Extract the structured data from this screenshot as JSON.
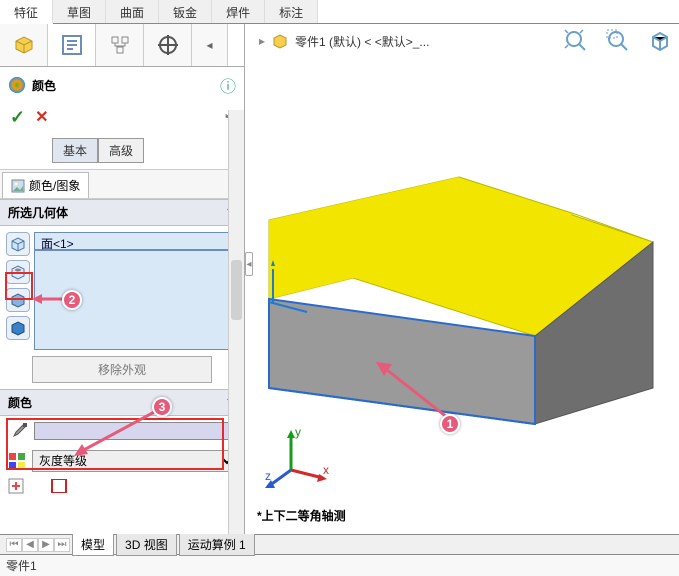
{
  "top_tabs": {
    "items": [
      "特征",
      "草图",
      "曲面",
      "钣金",
      "焊件",
      "标注"
    ],
    "active": 0
  },
  "panel": {
    "title": "颜色",
    "mode": {
      "basic": "基本",
      "advanced": "高级"
    },
    "subtab": "颜色/图象",
    "section_selected": "所选几何体",
    "face_label": "面<1>",
    "remove_appearance": "移除外观",
    "section_color": "颜色",
    "gray_scale": "灰度等级"
  },
  "doc": {
    "part_tree": "零件1 (默认) < <默认>_...",
    "view_name": "*上下二等角轴测",
    "status": "零件1"
  },
  "model_tabs": {
    "items": [
      "模型",
      "3D 视图",
      "运动算例 1"
    ],
    "active": 0
  },
  "annotations": {
    "n1": "1",
    "n2": "2",
    "n3": "3"
  },
  "triad": {
    "x": "x",
    "y": "y",
    "z": "z"
  },
  "colors": {
    "model_top": "#f2e600",
    "model_front": "#9a9a9a",
    "edge": "#2a6acc"
  }
}
